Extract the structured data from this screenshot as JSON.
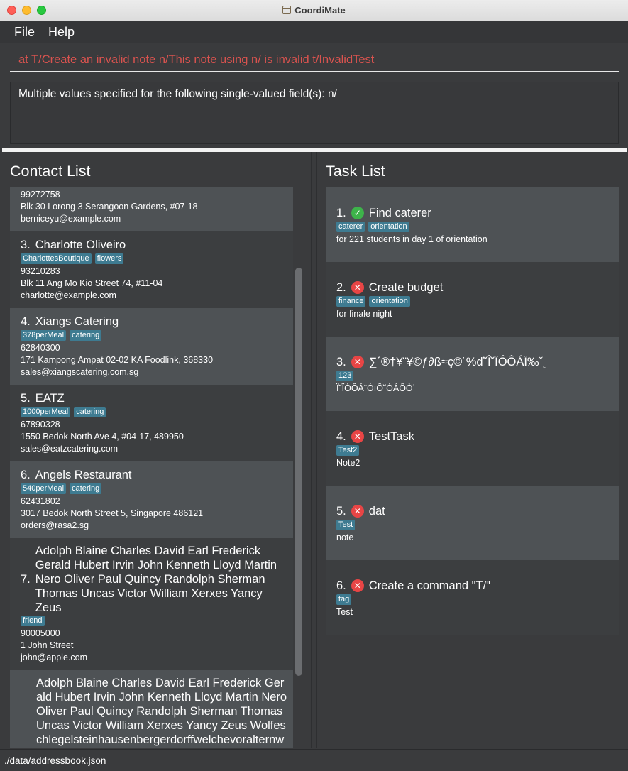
{
  "window": {
    "title": "CoordiMate"
  },
  "menu": {
    "file": "File",
    "help": "Help"
  },
  "command": {
    "text": "at T/Create an invalid note n/This note using n/ is invalid t/InvalidTest"
  },
  "result": {
    "text": "Multiple values specified for the following single-valued field(s): n/"
  },
  "contacts": {
    "title": "Contact List",
    "partial_top": {
      "phone": "99272758",
      "address": "Blk 30 Lorong 3 Serangoon Gardens, #07-18",
      "email": "berniceyu@example.com"
    },
    "items": [
      {
        "index": "3.",
        "name": "Charlotte Oliveiro",
        "tags": [
          "CharlottesBoutique",
          "flowers"
        ],
        "phone": "93210283",
        "address": "Blk 11 Ang Mo Kio Street 74, #11-04",
        "email": "charlotte@example.com"
      },
      {
        "index": "4.",
        "name": "Xiangs Catering",
        "tags": [
          "378perMeal",
          "catering"
        ],
        "phone": "62840300",
        "address": "171 Kampong Ampat 02-02 KA Foodlink, 368330",
        "email": "sales@xiangscatering.com.sg"
      },
      {
        "index": "5.",
        "name": "EATZ",
        "tags": [
          "1000perMeal",
          "catering"
        ],
        "phone": "67890328",
        "address": "1550 Bedok North Ave 4, #04-17, 489950",
        "email": "sales@eatzcatering.com"
      },
      {
        "index": "6.",
        "name": "Angels Restaurant",
        "tags": [
          "540perMeal",
          "catering"
        ],
        "phone": "62431802",
        "address": "3017 Bedok North Street 5, Singapore 486121",
        "email": "orders@rasa2.sg"
      },
      {
        "index": "7.",
        "name": "Adolph Blaine Charles David Earl Frederick Gerald Hubert Irvin John Kenneth Lloyd Martin Nero Oliver Paul Quincy Randolph Sherman Thomas Uncas Victor William Xerxes Yancy Zeus",
        "tags": [
          "friend"
        ],
        "phone": "90005000",
        "address": "1 John Street",
        "email": "john@apple.com"
      }
    ],
    "partial_bottom": {
      "name": "Adolph Blaine Charles David Earl Frederick Gerald Hubert Irvin John Kenneth Lloyd Martin Nero Oliver Paul Quincy Randolph Sherman Thomas Uncas Victor William Xerxes Yancy Zeus Wolfeschlegelsteinhausenbergerdorffwelchevoralternwarengewissenhaftschaferswessenschafewarenwohlgepflegeundsorgfaltigkeitbeschutzenvonangreifen"
    }
  },
  "tasks": {
    "title": "Task List",
    "items": [
      {
        "index": "1.",
        "status": "done",
        "title": "Find caterer",
        "tags": [
          "caterer",
          "orientation"
        ],
        "note": "for 221 students in day 1 of orientation"
      },
      {
        "index": "2.",
        "status": "not-done",
        "title": "Create budget",
        "tags": [
          "finance",
          "orientation"
        ],
        "note": "for finale night"
      },
      {
        "index": "3.",
        "status": "not-done",
        "title": "∑´®†¥¨¥©ƒ∂ß≈ç©˙%ď˘Î˘ÏÓÔÁÏ‰ˇ˛",
        "tags": [
          "123"
        ],
        "note": "Ï˘ÏÓÔÁ¨ÓıÔ˘ÓÁÔÒ˙"
      },
      {
        "index": "4.",
        "status": "not-done",
        "title": "TestTask",
        "tags": [
          "Test2"
        ],
        "note": "Note2"
      },
      {
        "index": "5.",
        "status": "not-done",
        "title": "dat",
        "tags": [
          "Test"
        ],
        "note": "note"
      },
      {
        "index": "6.",
        "status": "not-done",
        "title": "Create a command \"T/\"",
        "tags": [
          "tag"
        ],
        "note": "Test"
      }
    ]
  },
  "status_bar": {
    "path": "./data/addressbook.json"
  },
  "icons": {
    "done": "check-circle-icon",
    "not_done": "cross-circle-icon"
  },
  "colors": {
    "tag": "#3e7b91",
    "done": "#3db34a",
    "not_done": "#e84545",
    "error_text": "#d9534f"
  }
}
